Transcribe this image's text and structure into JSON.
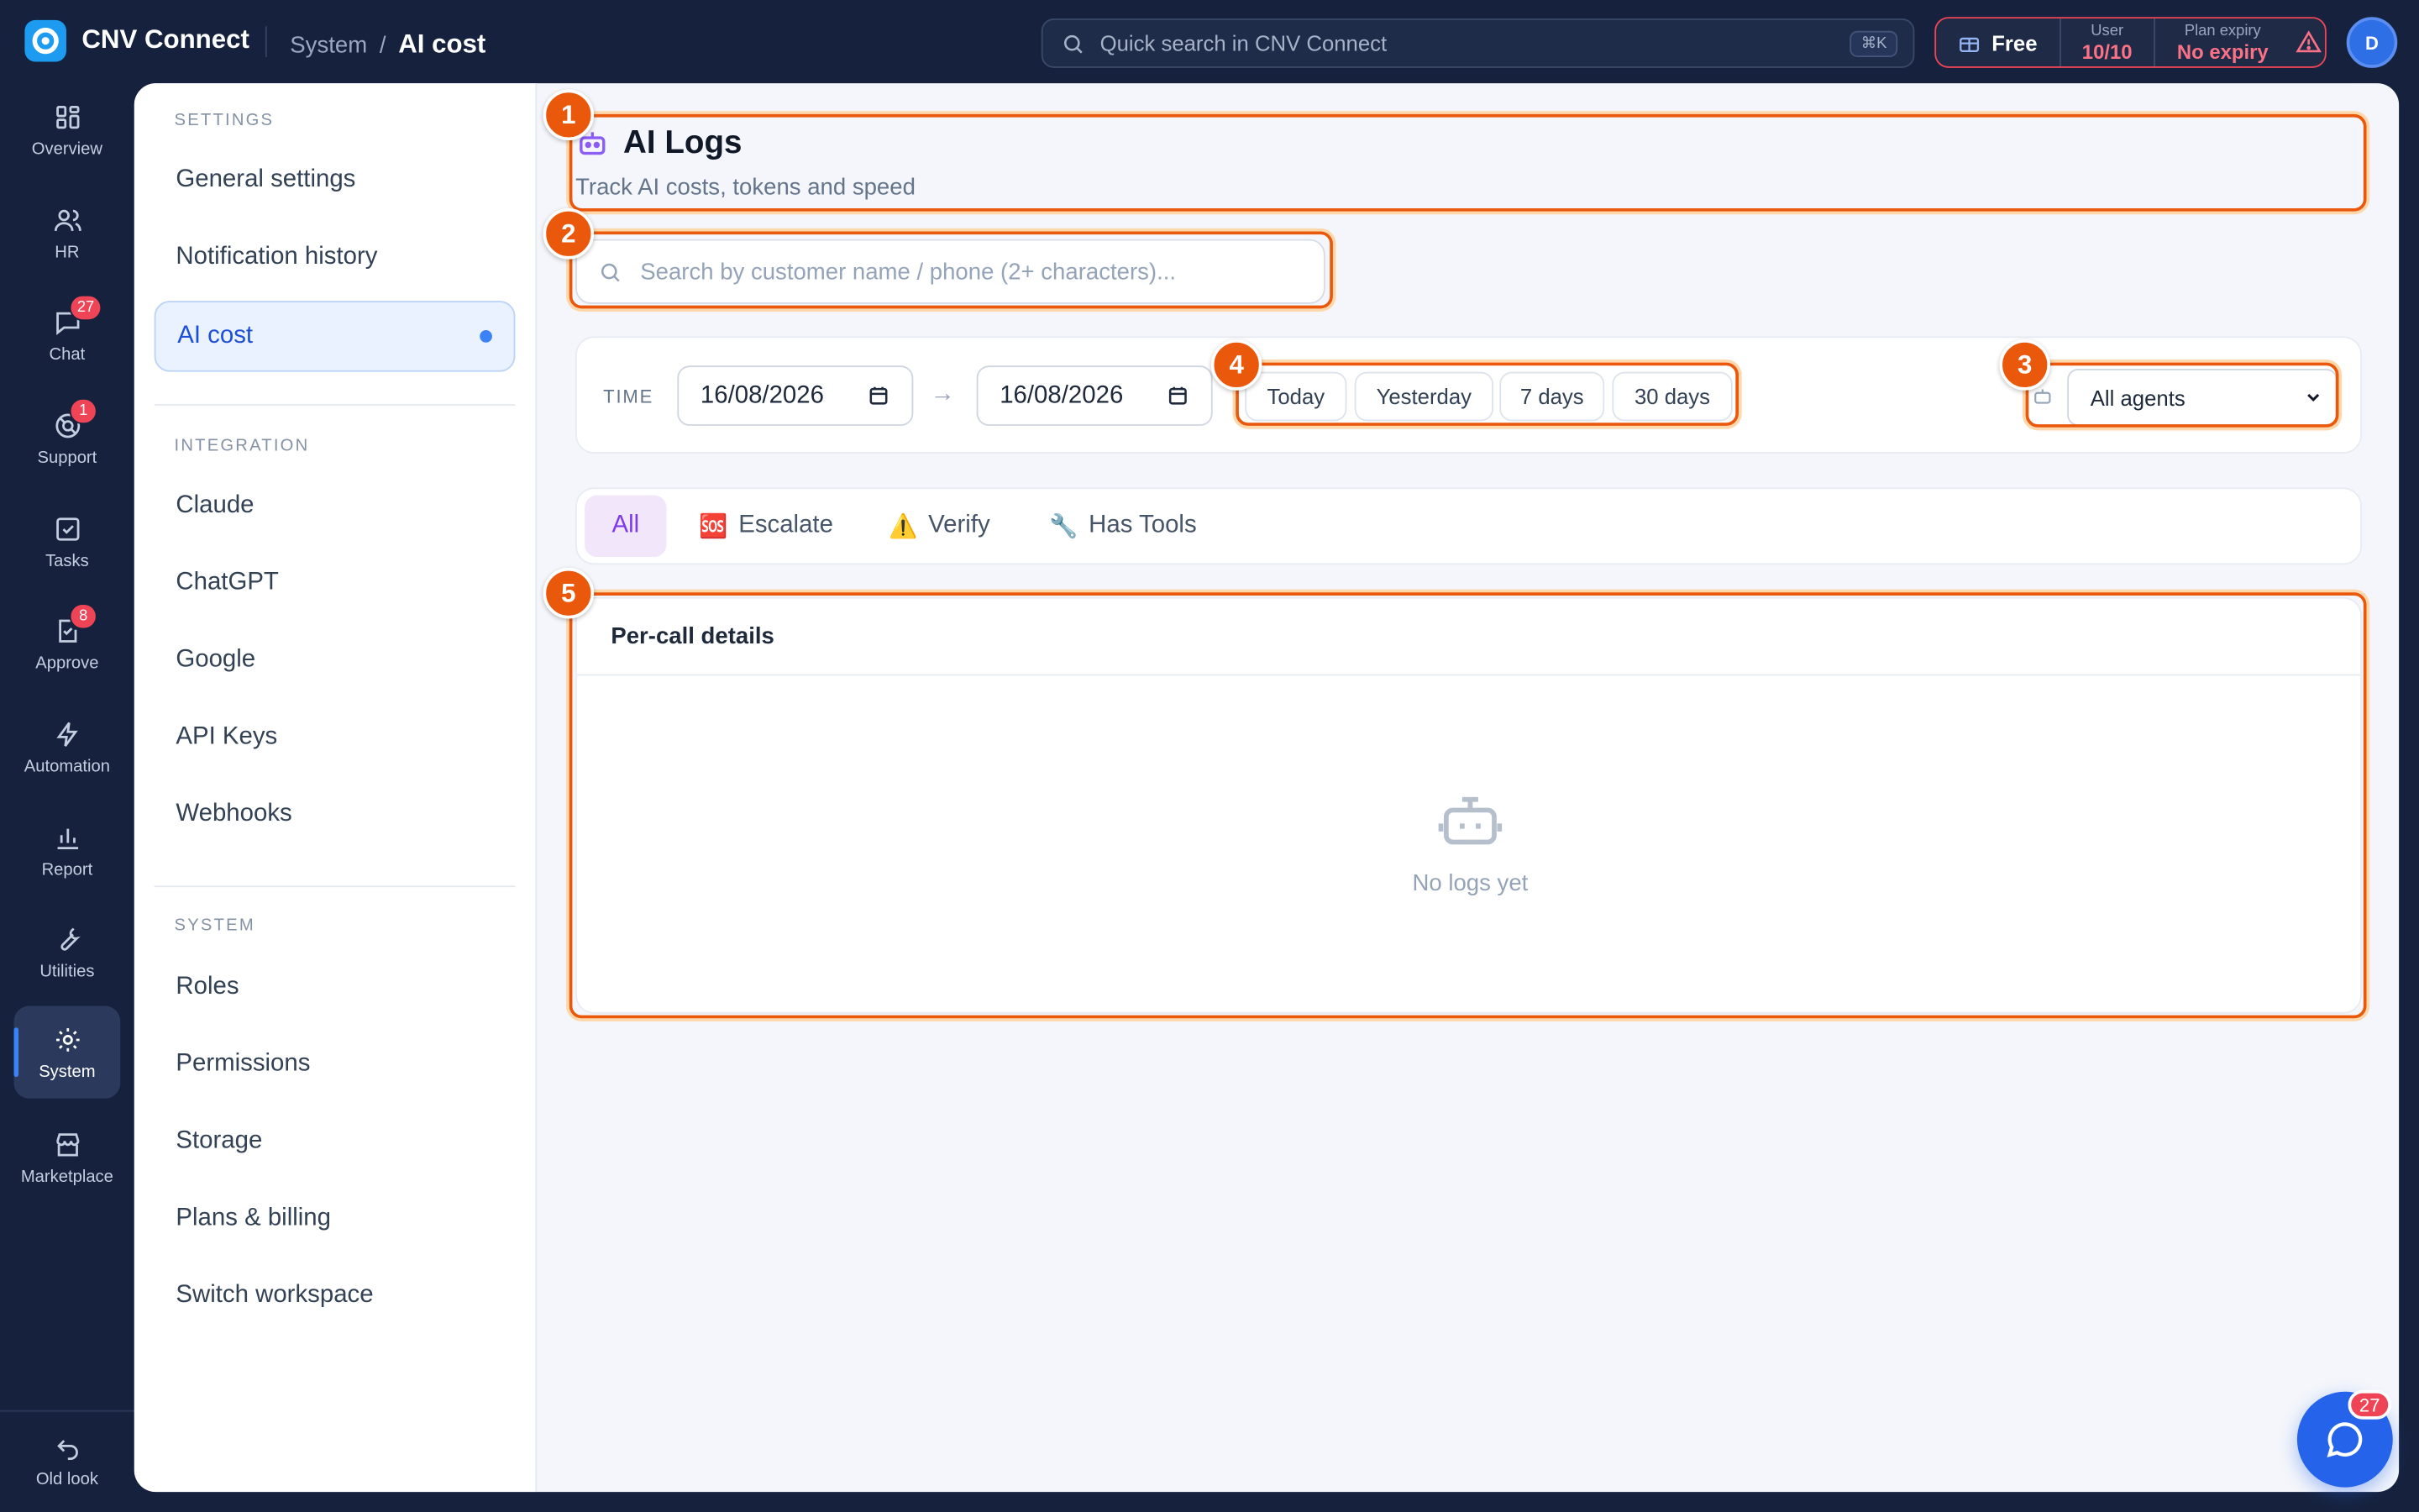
{
  "app": {
    "name": "CNV Connect"
  },
  "breadcrumb": {
    "parent": "System",
    "separator": "/",
    "current": "AI cost"
  },
  "top_search": {
    "placeholder": "Quick search in CNV Connect",
    "shortcut": "⌘K"
  },
  "plan": {
    "name": "Free",
    "user_label": "User",
    "user_value": "10/10",
    "expiry_label": "Plan expiry",
    "expiry_value": "No expiry"
  },
  "avatar": {
    "initial": "D"
  },
  "rail": {
    "items": [
      {
        "label": "Overview",
        "icon": "grid-icon"
      },
      {
        "label": "HR",
        "icon": "users-icon"
      },
      {
        "label": "Chat",
        "icon": "chat-icon",
        "badge": "27"
      },
      {
        "label": "Support",
        "icon": "support-icon",
        "badge": "1"
      },
      {
        "label": "Tasks",
        "icon": "checkbox-icon"
      },
      {
        "label": "Approve",
        "icon": "approve-icon",
        "badge": "8"
      },
      {
        "label": "Automation",
        "icon": "bolt-icon"
      },
      {
        "label": "Report",
        "icon": "bar-chart-icon"
      },
      {
        "label": "Utilities",
        "icon": "wrench-icon"
      },
      {
        "label": "System",
        "icon": "gear-icon",
        "active": true
      },
      {
        "label": "Marketplace",
        "icon": "store-icon"
      }
    ],
    "bottom": {
      "label": "Old look",
      "icon": "undo-icon"
    }
  },
  "sidebar": {
    "settings_title": "SETTINGS",
    "settings_items": [
      "General settings",
      "Notification history",
      "AI cost"
    ],
    "integration_title": "INTEGRATION",
    "integration_items": [
      "Claude",
      "ChatGPT",
      "Google",
      "API Keys",
      "Webhooks"
    ],
    "system_title": "SYSTEM",
    "system_items": [
      "Roles",
      "Permissions",
      "Storage",
      "Plans & billing",
      "Switch workspace"
    ]
  },
  "page": {
    "title": "AI Logs",
    "subtitle": "Track AI costs, tokens and speed",
    "search_placeholder": "Search by customer name / phone (2+ characters)...",
    "time_label": "TIME",
    "date_from": "16/08/2026",
    "date_to": "16/08/2026",
    "quick_ranges": [
      "Today",
      "Yesterday",
      "7 days",
      "30 days"
    ],
    "agent_filter": "All agents",
    "tabs": [
      {
        "label": "All",
        "emoji": ""
      },
      {
        "label": "Escalate",
        "emoji": "🆘"
      },
      {
        "label": "Verify",
        "emoji": "⚠️"
      },
      {
        "label": "Has Tools",
        "emoji": "🔧"
      }
    ],
    "details_title": "Per-call details",
    "empty_text": "No logs yet"
  },
  "annotations": [
    "1",
    "2",
    "3",
    "4",
    "5"
  ],
  "chat_fab": {
    "badge": "27"
  },
  "colors": {
    "accent": "#3b82f6",
    "highlight": "#ea580c",
    "badge": "#ef4456",
    "tab_active": "#7c3aed"
  }
}
